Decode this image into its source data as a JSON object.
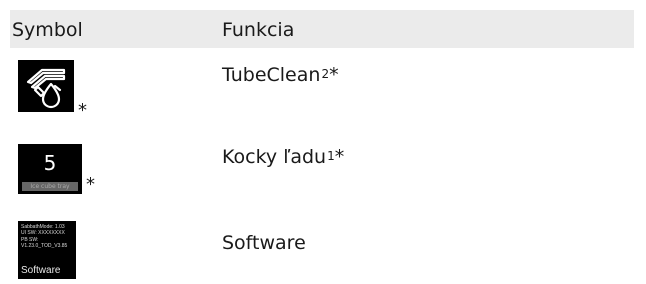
{
  "table": {
    "header": {
      "symbol": "Symbol",
      "function": "Funkcia"
    },
    "rows": [
      {
        "icon": "tubeclean-icon",
        "asterisk": "*",
        "function": "TubeClean",
        "sup": "2",
        "suffix": "*"
      },
      {
        "icon": "ice-cube-icon",
        "icon_number": "5",
        "icon_caption": "Ice cube tray",
        "asterisk": "*",
        "function": "Kocky ľadu",
        "sup": "1",
        "suffix": "*"
      },
      {
        "icon": "software-icon",
        "icon_lines": [
          "SabbathMode: 1.03",
          "UI SW: XXXXXXXX",
          "PB SW:",
          "V1.23.0_TOD_V3.85"
        ],
        "icon_footer": "Software",
        "function": "Software"
      }
    ]
  }
}
